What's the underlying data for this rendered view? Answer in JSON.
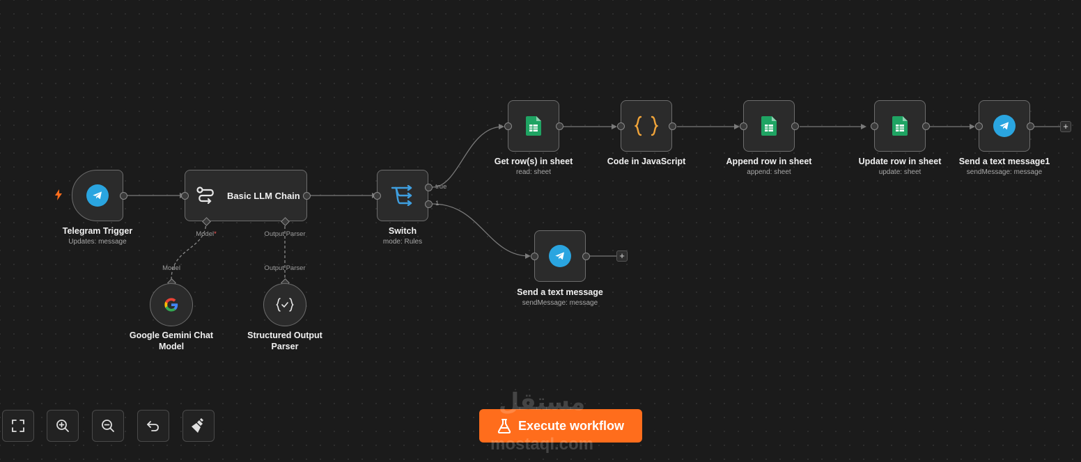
{
  "workflow": {
    "nodes": {
      "telegram_trigger": {
        "title": "Telegram Trigger",
        "subtitle": "Updates: message",
        "icon": "telegram-icon"
      },
      "llm_chain": {
        "title": "Basic LLM Chain",
        "icon": "llm-chain-icon"
      },
      "gemini": {
        "title": "Google Gemini Chat Model",
        "icon": "google-icon"
      },
      "output_parser": {
        "title": "Structured Output Parser",
        "icon": "json-check-icon"
      },
      "switch": {
        "title": "Switch",
        "subtitle": "mode: Rules",
        "icon": "switch-icon"
      },
      "get_rows": {
        "title": "Get row(s) in sheet",
        "subtitle": "read: sheet",
        "icon": "google-sheets-icon"
      },
      "code_js": {
        "title": "Code in JavaScript",
        "icon": "code-braces-icon"
      },
      "append_row": {
        "title": "Append row in sheet",
        "subtitle": "append: sheet",
        "icon": "google-sheets-icon"
      },
      "update_row": {
        "title": "Update row in sheet",
        "subtitle": "update: sheet",
        "icon": "google-sheets-icon"
      },
      "send_msg1": {
        "title": "Send a text message1",
        "subtitle": "sendMessage: message",
        "icon": "telegram-icon"
      },
      "send_msg": {
        "title": "Send a text message",
        "subtitle": "sendMessage: message",
        "icon": "telegram-icon"
      }
    },
    "connection_labels": {
      "model": "Model",
      "model_required": "*",
      "output_parser": "Output Parser",
      "model_sub": "Model",
      "output_parser_sub": "Output Parser"
    },
    "branch_labels": {
      "true": "true",
      "one": "1"
    },
    "plus": "+"
  },
  "toolbar": {
    "fit_view": "fit-view-icon",
    "zoom_in": "zoom-in-icon",
    "zoom_out": "zoom-out-icon",
    "reset": "undo-icon",
    "tidy": "broom-icon"
  },
  "execute_button": {
    "label": "Execute workflow",
    "icon": "flask-icon"
  },
  "watermark": {
    "arabic": "مستقل",
    "latin": "mostaql.com"
  },
  "colors": {
    "accent": "#ff6d1c",
    "telegram": "#2aa5e0",
    "sheets": "#1fa463",
    "code": "#f0a43a",
    "switch": "#3f9fe0",
    "canvas": "#1b1b1b",
    "node_bg": "#2b2b2b"
  }
}
